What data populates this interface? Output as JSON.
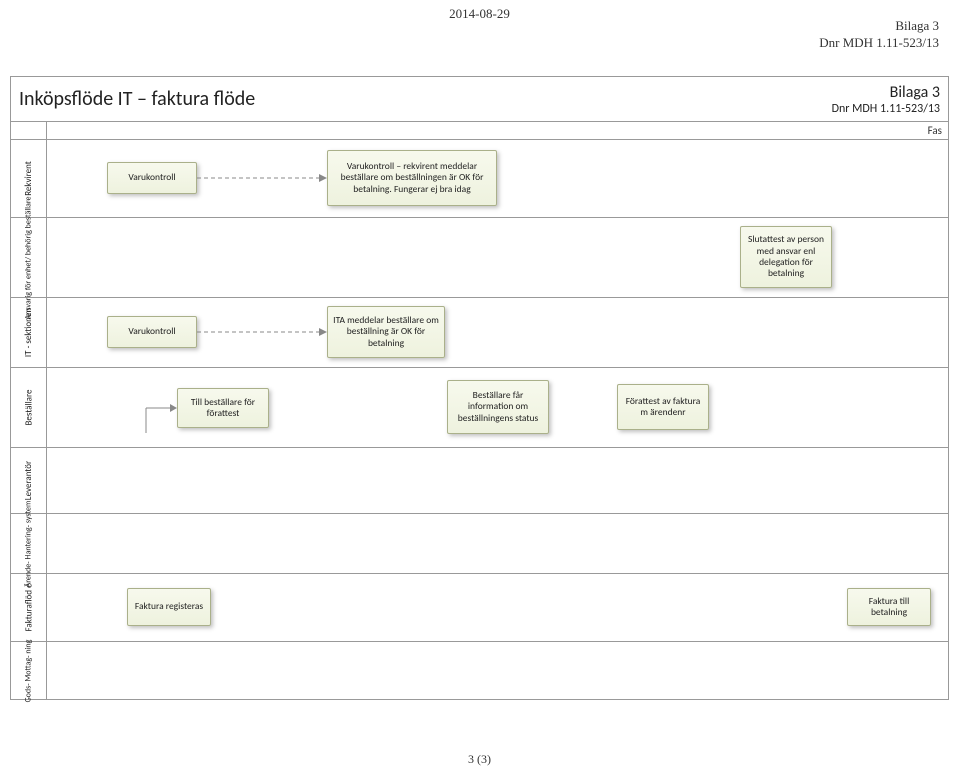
{
  "header": {
    "date": "2014-08-29",
    "right1": "Bilaga 3",
    "right2": "Dnr MDH 1.11-523/13"
  },
  "title": {
    "left": "Inköpsflöde IT – faktura flöde",
    "right_top": "Bilaga 3",
    "right_bottom": "Dnr MDH 1.11-523/13",
    "fas": "Fas"
  },
  "lanes": {
    "rekvirent": "Rekvirent",
    "ansvarig": "Ansvarig för enhet/ behörig beställare",
    "it": "IT - sektionen",
    "bestallare": "Beställare",
    "leverantor": "Leverantör",
    "arende": "Ärende- Hantering- system",
    "fakturaflode": "Fakturaflöd e",
    "gods": "Gods- Mottag- ning"
  },
  "boxes": {
    "varukontroll1": "Varukontroll",
    "varukontroll_msg": "Varukontroll – rekvirent meddelar beställare om beställningen är OK för betalning. Fungerar ej bra idag",
    "slutattest": "Slutattest av person med ansvar enl delegation för betalning",
    "varukontroll2": "Varukontroll",
    "ita_meddelar": "ITA meddelar beställare om beställning är OK för betalning",
    "till_bestallare": "Till beställare för förattest",
    "bestallare_info": "Beställare får information om beställningens status",
    "forattest": "Förattest av faktura m ärendenr",
    "faktura_reg": "Faktura registeras",
    "faktura_till": "Faktura till betalning"
  },
  "footer": "3 (3)"
}
